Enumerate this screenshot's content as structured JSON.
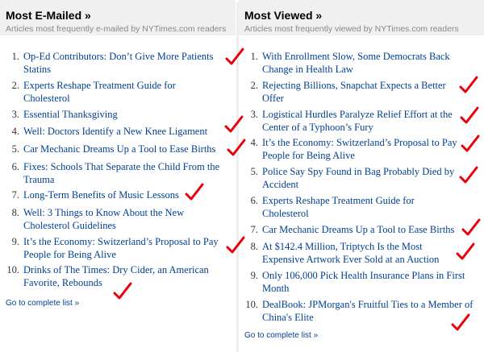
{
  "emailed": {
    "title": "Most E-Mailed »",
    "subtitle": "Articles most frequently e-mailed by NYTimes.com readers",
    "items": [
      {
        "num": "1.",
        "text": "Op-Ed Contributors: Don’t Give More Patients Statins"
      },
      {
        "num": "2.",
        "text": "Experts Reshape Treatment Guide for Cholesterol"
      },
      {
        "num": "3.",
        "text": "Essential Thanksgiving"
      },
      {
        "num": "4.",
        "text": "Well: Doctors Identify a New Knee Ligament"
      },
      {
        "num": "5.",
        "text": "Car Mechanic Dreams Up a Tool to Ease Births"
      },
      {
        "num": "6.",
        "text": "Fixes: Schools That Separate the Child From the Trauma"
      },
      {
        "num": "7.",
        "text": "Long-Term Benefits of Music Lessons"
      },
      {
        "num": "8.",
        "text": "Well: 3 Things to Know About the New Cholesterol Guidelines"
      },
      {
        "num": "9.",
        "text": "It’s the Economy: Switzerland’s Proposal to Pay People for Being Alive"
      },
      {
        "num": "10.",
        "text": "Drinks of The Times: Dry Cider, an American Favorite, Rebounds"
      }
    ],
    "more": "Go to complete list »"
  },
  "viewed": {
    "title": "Most Viewed »",
    "subtitle": "Articles most frequently viewed by NYTimes.com readers",
    "items": [
      {
        "num": "1.",
        "text": "With Enrollment Slow, Some Democrats Back Change in Health Law"
      },
      {
        "num": "2.",
        "text": "Rejecting Billions, Snapchat Expects a Better Offer"
      },
      {
        "num": "3.",
        "text": "Logistical Hurdles Paralyze Relief Effort at the Center of a Typhoon’s Fury"
      },
      {
        "num": "4.",
        "text": "It’s the Economy: Switzerland’s Proposal to Pay People for Being Alive"
      },
      {
        "num": "5.",
        "text": "Police Say Spy Found in Bag Probably Died by Accident"
      },
      {
        "num": "6.",
        "text": "Experts Reshape Treatment Guide for Cholesterol"
      },
      {
        "num": "7.",
        "text": "Car Mechanic Dreams Up a Tool to Ease Births"
      },
      {
        "num": "8.",
        "text": "At $142.4 Million, Triptych Is the Most Expensive Artwork Ever Sold at an Auction"
      },
      {
        "num": "9.",
        "text": "Only 106,000 Pick Health Insurance Plans in First Month"
      },
      {
        "num": "10.",
        "text": "DealBook: JPMorgan's Fruitful Ties to a Member of China's Elite"
      }
    ],
    "more": "Go to complete list »"
  },
  "colors": {
    "link": "#00408f",
    "header_bg": "#f0f0f0",
    "check_mark": "#e8000d"
  },
  "icons": {
    "check_mark": "check-mark-icon"
  }
}
